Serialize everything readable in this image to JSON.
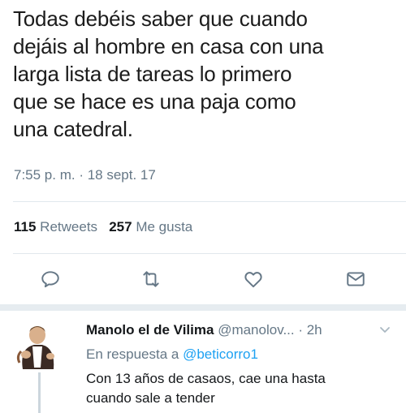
{
  "tweet": {
    "lines": [
      "Todas debéis saber que cuando",
      "dejáis al hombre en casa con una",
      "larga lista de tareas lo primero",
      "que se hace es una paja como",
      "una catedral."
    ],
    "timestamp": "7:55 p. m. · 18 sept. 17",
    "retweets_count": "115",
    "retweets_label": "Retweets",
    "likes_count": "257",
    "likes_label": "Me gusta"
  },
  "actions": {
    "reply_icon": "reply-icon",
    "retweet_icon": "retweet-icon",
    "like_icon": "heart-icon",
    "message_icon": "envelope-icon"
  },
  "reply": {
    "name": "Manolo el de Vilima",
    "handle": "@manolov...",
    "time": "· 2h",
    "in_reply_prefix": "En respuesta a",
    "in_reply_handle": "@beticorro1",
    "text_line1": "Con 13 años de casaos, cae una hasta",
    "text_line2": "cuando sale a tender"
  },
  "colors": {
    "accent": "#1da1f2",
    "muted": "#657786",
    "text": "#14171a"
  }
}
